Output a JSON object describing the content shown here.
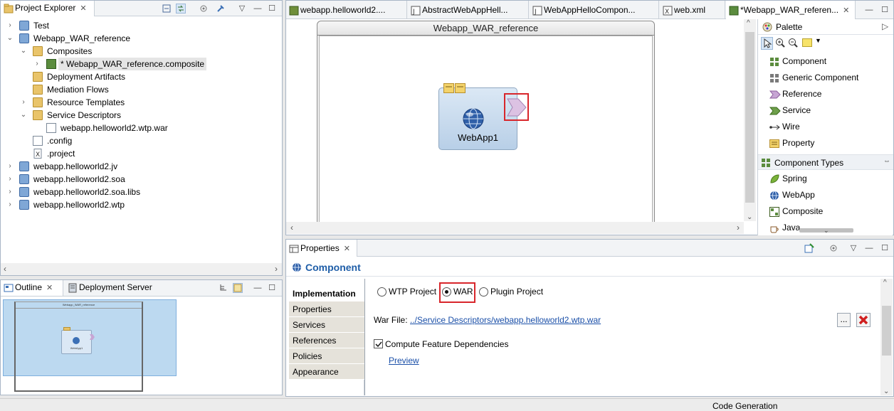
{
  "project_explorer": {
    "tab_label": "Project Explorer",
    "tree": [
      {
        "label": "Test",
        "arrow": "›"
      },
      {
        "label": "Webapp_WAR_reference",
        "arrow": "⌄"
      },
      {
        "label": "Composites",
        "arrow": "⌄"
      },
      {
        "label": "* Webapp_WAR_reference.composite",
        "arrow": "›"
      },
      {
        "label": "Deployment Artifacts",
        "arrow": ""
      },
      {
        "label": "Mediation Flows",
        "arrow": ""
      },
      {
        "label": "Resource Templates",
        "arrow": "›"
      },
      {
        "label": "Service Descriptors",
        "arrow": "⌄"
      },
      {
        "label": "webapp.helloworld2.wtp.war",
        "arrow": ""
      },
      {
        "label": ".config",
        "arrow": ""
      },
      {
        "label": ".project",
        "arrow": ""
      },
      {
        "label": "webapp.helloworld2.jv",
        "arrow": "›"
      },
      {
        "label": "webapp.helloworld2.soa",
        "arrow": "›"
      },
      {
        "label": "webapp.helloworld2.soa.libs",
        "arrow": "›"
      },
      {
        "label": "webapp.helloworld2.wtp",
        "arrow": "›"
      }
    ]
  },
  "outline": {
    "tab_label": "Outline",
    "tab2_label": "Deployment Server",
    "mini_title": "Webapp_WAR_reference",
    "mini_comp": "WebApp1"
  },
  "editor": {
    "tabs": [
      {
        "label": "webapp.helloworld2...."
      },
      {
        "label": "AbstractWebAppHell..."
      },
      {
        "label": "WebAppHelloCompon..."
      },
      {
        "label": "web.xml"
      },
      {
        "label": "*Webapp_WAR_referen..."
      }
    ],
    "composite_title": "Webapp_WAR_reference",
    "component_label": "WebApp1"
  },
  "palette": {
    "title": "Palette",
    "items": [
      {
        "label": "Component"
      },
      {
        "label": "Generic Component"
      },
      {
        "label": "Reference"
      },
      {
        "label": "Service"
      },
      {
        "label": "Wire"
      },
      {
        "label": "Property"
      }
    ],
    "section_label": "Component Types",
    "types": [
      {
        "label": "Spring"
      },
      {
        "label": "WebApp"
      },
      {
        "label": "Composite"
      },
      {
        "label": "Java"
      }
    ]
  },
  "properties": {
    "tab_label": "Properties",
    "header": "Component",
    "side_tabs": [
      "Implementation",
      "Properties",
      "Services",
      "References",
      "Policies",
      "Appearance"
    ],
    "radio_options": [
      {
        "label": "WTP Project",
        "selected": false
      },
      {
        "label": "WAR",
        "selected": true
      },
      {
        "label": "Plugin Project",
        "selected": false
      }
    ],
    "war_file_label": "War File:",
    "war_file_link": "../Service Descriptors/webapp.helloworld2.wtp.war",
    "browse_label": "...",
    "checkbox_label": "Compute Feature Dependencies",
    "checkbox_checked": true,
    "preview_link": "Preview"
  },
  "status_bar": {
    "text": "Code Generation"
  },
  "colors": {
    "highlight": "#d8262b",
    "link": "#1a4fa8",
    "outline_viewport": "#bcd9f0"
  }
}
